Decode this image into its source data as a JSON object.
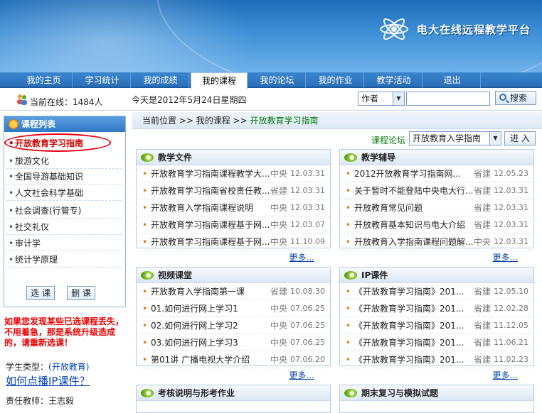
{
  "header": {
    "title": "电大在线远程教学平台"
  },
  "nav": {
    "tabs": [
      "我的主页",
      "学习统计",
      "我的成绩",
      "我的课程",
      "我的论坛",
      "我的作业",
      "教学活动",
      "退出"
    ],
    "active": "我的课程"
  },
  "info": {
    "online": "当前在线：1484人",
    "today": "今天是2012年5月24日星期四"
  },
  "search": {
    "select": "作者",
    "button": "搜索"
  },
  "sidebar": {
    "title": "课程列表",
    "courses": [
      "开放教育学习指南",
      "旅游文化",
      "全国导游基础知识",
      "人文社会科学基础",
      "社会调查(行管专)",
      "社交礼仪",
      "审计学",
      "统计学原理"
    ],
    "select_btn": "选 课",
    "delete_btn": "删 课"
  },
  "warning": "如果您发现某些已选课程丢失，不用着急，那是系统升级造成的，请重新选课！",
  "student": {
    "label": "学生类型：",
    "value": "(开放教育)"
  },
  "howto": "如何点播IP课件？",
  "teacher": "责任教师：王志毅",
  "breadcrumb": {
    "prefix": "当前位置 >> 我的课程 >>",
    "current": "开放教育学习指南"
  },
  "forum": {
    "label": "课程论坛",
    "select": "开放教育入学指南",
    "button": "进 入"
  },
  "panels": [
    {
      "title": "教学文件",
      "more": "更多...",
      "rows": [
        {
          "t": "开放教育学习指南课程教学大...",
          "s": "中央",
          "d": "12.03.31"
        },
        {
          "t": "开放教育学习指南省校责任教...",
          "s": "省建",
          "d": "12.03.31"
        },
        {
          "t": "开放教育入学指南课程说明",
          "s": "中央",
          "d": "12.03.31"
        },
        {
          "t": "开放教育学习指南课程基于网...",
          "s": "中央",
          "d": "12.03.07"
        },
        {
          "t": "开放教育学习指南课程基于网...",
          "s": "中央",
          "d": "11.10.09"
        }
      ]
    },
    {
      "title": "教学辅导",
      "more": "更多...",
      "rows": [
        {
          "t": "2012开放教育学习指南网...",
          "s": "省建",
          "d": "12.05.23"
        },
        {
          "t": "关于暂时不能登陆中央电大行...",
          "s": "省建",
          "d": "12.03.31"
        },
        {
          "t": "开放教育常见问题",
          "s": "省建",
          "d": "12.03.31"
        },
        {
          "t": "开放教育基本知识与电大介绍",
          "s": "省建",
          "d": "12.03.31"
        },
        {
          "t": "开放教育入学指南课程问题解...",
          "s": "中央",
          "d": "12.03.31"
        }
      ]
    },
    {
      "title": "视频课堂",
      "more": "更多...",
      "rows": [
        {
          "t": "开放教育入学指南第一课",
          "s": "省建",
          "d": "10.08.30"
        },
        {
          "t": "01.如何进行网上学习1",
          "s": "中央",
          "d": "07.06.25"
        },
        {
          "t": "02.如何进行网上学习2",
          "s": "中央",
          "d": "07.06.25"
        },
        {
          "t": "03.如何进行网上学习3",
          "s": "中央",
          "d": "07.06.25"
        },
        {
          "t": "第01讲 广播电视大学介绍",
          "s": "中央",
          "d": "07.06.20"
        }
      ]
    },
    {
      "title": "IP课件",
      "more": "更多...",
      "rows": [
        {
          "t": "《开放教育学习指南》201...",
          "s": "省建",
          "d": "12.05.10"
        },
        {
          "t": "《开放教育学习指南》201...",
          "s": "省建",
          "d": "12.02.28"
        },
        {
          "t": "《开放教育学习指南》201...",
          "s": "省建",
          "d": "11.12.05"
        },
        {
          "t": "《开放教育学习指南》201...",
          "s": "省建",
          "d": "11.06.21"
        },
        {
          "t": "《开放教育学习指南》201...",
          "s": "省建",
          "d": "11.02.23"
        }
      ]
    },
    {
      "title": "考核说明与形考作业",
      "more": "",
      "rows": []
    },
    {
      "title": "期末复习与模拟试题",
      "more": "",
      "rows": []
    }
  ]
}
